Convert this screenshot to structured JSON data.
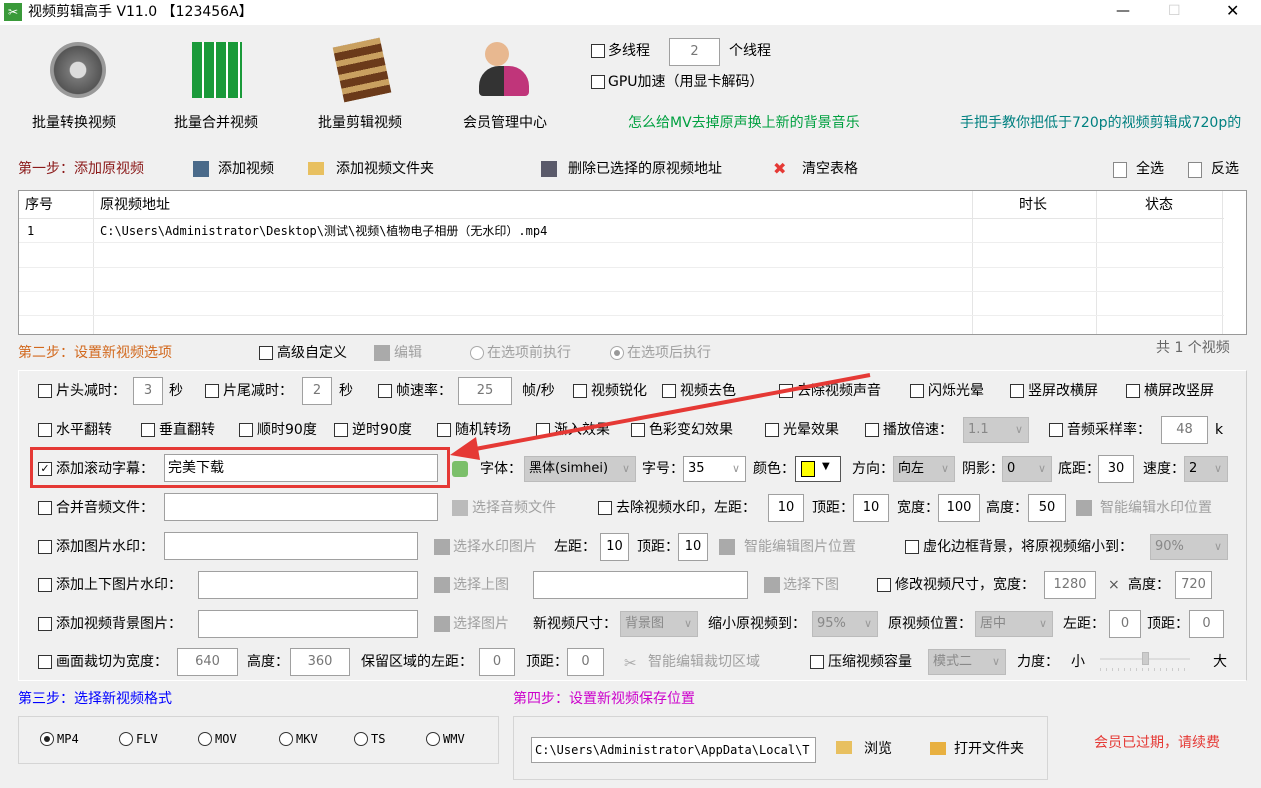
{
  "title": "视频剪辑高手 V11.0 【123456A】",
  "toolbar": [
    {
      "label": "批量转换视频"
    },
    {
      "label": "批量合并视频"
    },
    {
      "label": "批量剪辑视频"
    },
    {
      "label": "会员管理中心"
    }
  ],
  "threads": {
    "multi_label": "多线程",
    "count": "2",
    "unit": "个线程",
    "gpu_label": "GPU加速（用显卡解码）"
  },
  "links": [
    "怎么给MV去掉原声换上新的背景音乐",
    "手把手教你把低于720p的视频剪辑成720p的"
  ],
  "step1": {
    "label": "第一步：添加原视频",
    "add_video": "添加视频",
    "add_folder": "添加视频文件夹",
    "delete_selected": "删除已选择的原视频地址",
    "clear": "清空表格",
    "select_all": "全选",
    "invert": "反选"
  },
  "table": {
    "headers": [
      "序号",
      "原视频地址",
      "时长",
      "状态"
    ],
    "rows": [
      [
        "1",
        "C:\\Users\\Administrator\\Desktop\\测试\\视频\\植物电子相册（无水印）.mp4",
        "",
        ""
      ]
    ]
  },
  "step2": {
    "label": "第二步：设置新视频选项",
    "advanced": "高级自定义",
    "edit": "编辑",
    "before": "在选项前执行",
    "after": "在选项后执行",
    "count": "共 1 个视频"
  },
  "opts": {
    "head_cut": "片头减时：",
    "head_val": "3",
    "sec": "秒",
    "tail_cut": "片尾减时：",
    "tail_val": "2",
    "fps": "帧速率：",
    "fps_val": "25",
    "fps_unit": "帧/秒",
    "sharpen": "视频锐化",
    "decolor": "视频去色",
    "mute": "去除视频声音",
    "flash": "闪烁光晕",
    "v2h": "竖屏改横屏",
    "h2v": "横屏改竖屏",
    "hflip": "水平翻转",
    "vflip": "垂直翻转",
    "cw90": "顺时90度",
    "ccw90": "逆时90度",
    "trans": "随机转场",
    "fadein": "渐入效果",
    "color_fx": "色彩变幻效果",
    "halo": "光晕效果",
    "speed": "播放倍速：",
    "speed_val": "1.1",
    "sample": "音频采样率：",
    "sample_val": "48",
    "sample_unit": "k",
    "subtitle": "添加滚动字幕：",
    "subtitle_val": "完美下载",
    "font": "字体：",
    "font_val": "黑体(simhei)",
    "size": "字号：",
    "size_val": "35",
    "color": "颜色：",
    "color_hex": "#ffff00",
    "dir": "方向：",
    "dir_val": "向左",
    "shadow": "阴影：",
    "shadow_val": "0",
    "bottom": "底距：",
    "bottom_val": "30",
    "rate": "速度：",
    "rate_val": "2",
    "merge_audio": "合并音频文件：",
    "choose_audio": "选择音频文件",
    "rm_wm": "去除视频水印，左距：",
    "wm_left": "10",
    "top": "顶距：",
    "wm_top": "10",
    "width": "宽度：",
    "wm_w": "100",
    "height": "高度：",
    "wm_h": "50",
    "smart_wm": "智能编辑水印位置",
    "img_wm": "添加图片水印：",
    "choose_wm": "选择水印图片",
    "left": "左距：",
    "iw_left": "10",
    "iw_top": "10",
    "smart_img": "智能编辑图片位置",
    "blur": "虚化边框背景，将原视频缩小到：",
    "blur_val": "90%",
    "tb_wm": "添加上下图片水印：",
    "choose_top": "选择上图",
    "choose_bottom": "选择下图",
    "resize": "修改视频尺寸，宽度：",
    "resize_w": "1280",
    "times": "×",
    "resize_h_label": "高度：",
    "resize_h": "720",
    "bg_img": "添加视频背景图片：",
    "choose_img": "选择图片",
    "new_size": "新视频尺寸：",
    "new_size_val": "背景图",
    "shrink": "缩小原视频到：",
    "shrink_val": "95%",
    "pos": "原视频位置：",
    "pos_val": "居中",
    "bg_left": "0",
    "bg_top": "0",
    "crop": "画面裁切为宽度：",
    "crop_w": "640",
    "crop_h": "360",
    "keep": "保留区域的左距：",
    "crop_left": "0",
    "crop_top": "0",
    "smart_crop": "智能编辑裁切区域",
    "compress": "压缩视频容量",
    "mode_val": "模式二",
    "strength": "力度：",
    "small": "小",
    "big": "大"
  },
  "step3": {
    "label": "第三步：选择新视频格式",
    "formats": [
      "MP4",
      "FLV",
      "MOV",
      "MKV",
      "TS",
      "WMV"
    ],
    "selected": "MP4"
  },
  "step4": {
    "label": "第四步：设置新视频保存位置",
    "path": "C:\\Users\\Administrator\\AppData\\Local\\T",
    "browse": "浏览",
    "open": "打开文件夹"
  },
  "status": "会员已过期，请续费",
  "colors": {
    "step1": "#8b1a1a",
    "step2": "#d2691e",
    "step3": "#0000ff",
    "step4": "#cc00cc",
    "link1": "#00a040",
    "link2": "#008080",
    "highlight": "#e53935"
  }
}
